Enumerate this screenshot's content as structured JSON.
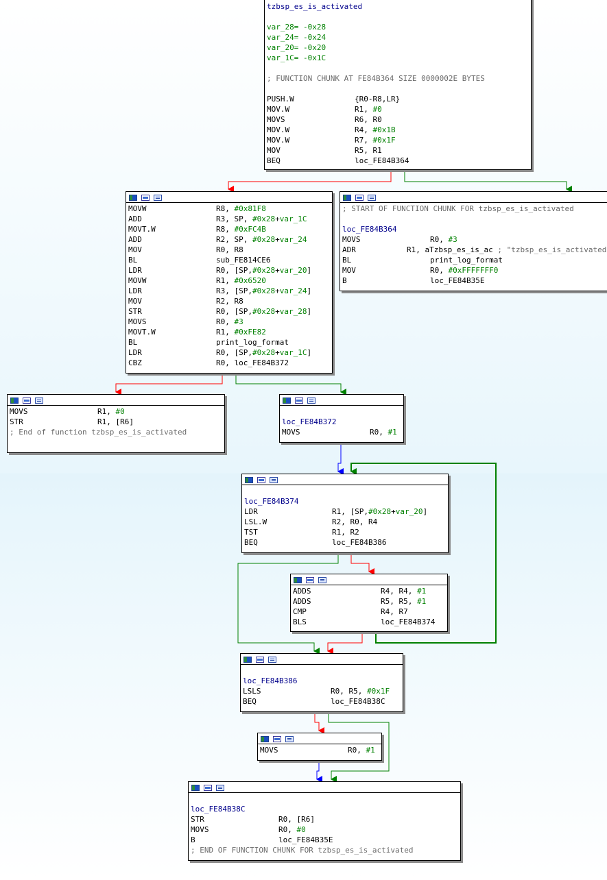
{
  "graph": {
    "nodes": [
      {
        "id": "n0",
        "lines": [
          {
            "label": "tzbsp_es_is_activated"
          },
          {
            "blank": true
          },
          {
            "var": "var_28",
            "value": "= -0x28"
          },
          {
            "var": "var_24",
            "value": "= -0x24"
          },
          {
            "var": "var_20",
            "value": "= -0x20"
          },
          {
            "var": "var_1C",
            "value": "= -0x1C"
          },
          {
            "blank": true
          },
          {
            "comment": "; FUNCTION CHUNK AT FE84B364 SIZE 0000002E BYTES"
          },
          {
            "blank": true
          },
          {
            "mn": "PUSH.W",
            "op": "{R0-R8,LR}"
          },
          {
            "mn": "MOV.W",
            "op": "R1, #0"
          },
          {
            "mn": "MOVS",
            "op": "R6, R0"
          },
          {
            "mn": "MOV.W",
            "op": "R4, #0x1B"
          },
          {
            "mn": "MOV.W",
            "op": "R7, #0x1F"
          },
          {
            "mn": "MOV",
            "op": "R5, R1"
          },
          {
            "mn": "BEQ",
            "op": "loc_FE84B364"
          }
        ]
      },
      {
        "id": "n1",
        "lines": [
          {
            "mn": "MOVW",
            "op": "R8, #0x81F8"
          },
          {
            "mn": "ADD",
            "op": "R3, SP, #0x28+var_1C"
          },
          {
            "mn": "MOVT.W",
            "op": "R8, #0xFC4B"
          },
          {
            "mn": "ADD",
            "op": "R2, SP, #0x28+var_24"
          },
          {
            "mn": "MOV",
            "op": "R0, R8"
          },
          {
            "mn": "BL",
            "op": "sub_FE814CE6"
          },
          {
            "mn": "LDR",
            "op": "R0, [SP,#0x28+var_20]"
          },
          {
            "mn": "MOVW",
            "op": "R1, #0x6520"
          },
          {
            "mn": "LDR",
            "op": "R3, [SP,#0x28+var_24]"
          },
          {
            "mn": "MOV",
            "op": "R2, R8"
          },
          {
            "mn": "STR",
            "op": "R0, [SP,#0x28+var_28]"
          },
          {
            "mn": "MOVS",
            "op": "R0, #3"
          },
          {
            "mn": "MOVT.W",
            "op": "R1, #0xFE82"
          },
          {
            "mn": "BL",
            "op": "print_log_format"
          },
          {
            "mn": "LDR",
            "op": "R0, [SP,#0x28+var_1C]"
          },
          {
            "mn": "CBZ",
            "op": "R0, loc_FE84B372"
          }
        ]
      },
      {
        "id": "n2",
        "lines": [
          {
            "comment": "; START OF FUNCTION CHUNK FOR tzbsp_es_is_activated"
          },
          {
            "blank": true
          },
          {
            "label": "loc_FE84B364"
          },
          {
            "mn": "MOVS",
            "op": "R0, #3"
          },
          {
            "mn": "ADR",
            "op": "R1, aTzbsp_es_is_ac",
            "comment": " ; \"tzbsp_es_is_activated\""
          },
          {
            "mn": "BL",
            "op": "print_log_format"
          },
          {
            "mn": "MOV",
            "op": "R0, #0xFFFFFFF0"
          },
          {
            "mn": "B",
            "op": "loc_FE84B35E"
          }
        ]
      },
      {
        "id": "n3",
        "lines": [
          {
            "mn": "MOVS",
            "op": "R1, #0"
          },
          {
            "mn": "STR",
            "op": "R1, [R6]"
          },
          {
            "comment": "; End of function tzbsp_es_is_activated"
          }
        ]
      },
      {
        "id": "n4",
        "lines": [
          {
            "blank": true
          },
          {
            "label": "loc_FE84B372"
          },
          {
            "mn": "MOVS",
            "op": "R0, #1"
          }
        ]
      },
      {
        "id": "n5",
        "lines": [
          {
            "blank": true
          },
          {
            "label": "loc_FE84B374"
          },
          {
            "mn": "LDR",
            "op": "R1, [SP,#0x28+var_20]"
          },
          {
            "mn": "LSL.W",
            "op": "R2, R0, R4"
          },
          {
            "mn": "TST",
            "op": "R1, R2"
          },
          {
            "mn": "BEQ",
            "op": "loc_FE84B386"
          }
        ]
      },
      {
        "id": "n6",
        "lines": [
          {
            "mn": "ADDS",
            "op": "R4, R4, #1"
          },
          {
            "mn": "ADDS",
            "op": "R5, R5, #1"
          },
          {
            "mn": "CMP",
            "op": "R4, R7"
          },
          {
            "mn": "BLS",
            "op": "loc_FE84B374"
          }
        ]
      },
      {
        "id": "n7",
        "lines": [
          {
            "blank": true
          },
          {
            "label": "loc_FE84B386"
          },
          {
            "mn": "LSLS",
            "op": "R0, R5, #0x1F"
          },
          {
            "mn": "BEQ",
            "op": "loc_FE84B38C"
          }
        ]
      },
      {
        "id": "n8",
        "lines": [
          {
            "mn": "MOVS",
            "op": "R0, #1"
          }
        ]
      },
      {
        "id": "n9",
        "lines": [
          {
            "blank": true
          },
          {
            "label": "loc_FE84B38C"
          },
          {
            "mn": "STR",
            "op": "R0, [R6]"
          },
          {
            "mn": "MOVS",
            "op": "R0, #0"
          },
          {
            "mn": "B",
            "op": "loc_FE84B35E"
          },
          {
            "comment": "; END OF FUNCTION CHUNK FOR tzbsp_es_is_activated"
          }
        ]
      }
    ],
    "colors": {
      "edge_true": "#008000",
      "edge_false": "#ff0000",
      "edge_uncond": "#0000ff",
      "label": "#00008b",
      "comment": "#6a6a6a",
      "immediate": "#008000"
    },
    "toolbar_icons": [
      "graph-color-icon",
      "rename-icon",
      "xrefs-icon"
    ]
  }
}
